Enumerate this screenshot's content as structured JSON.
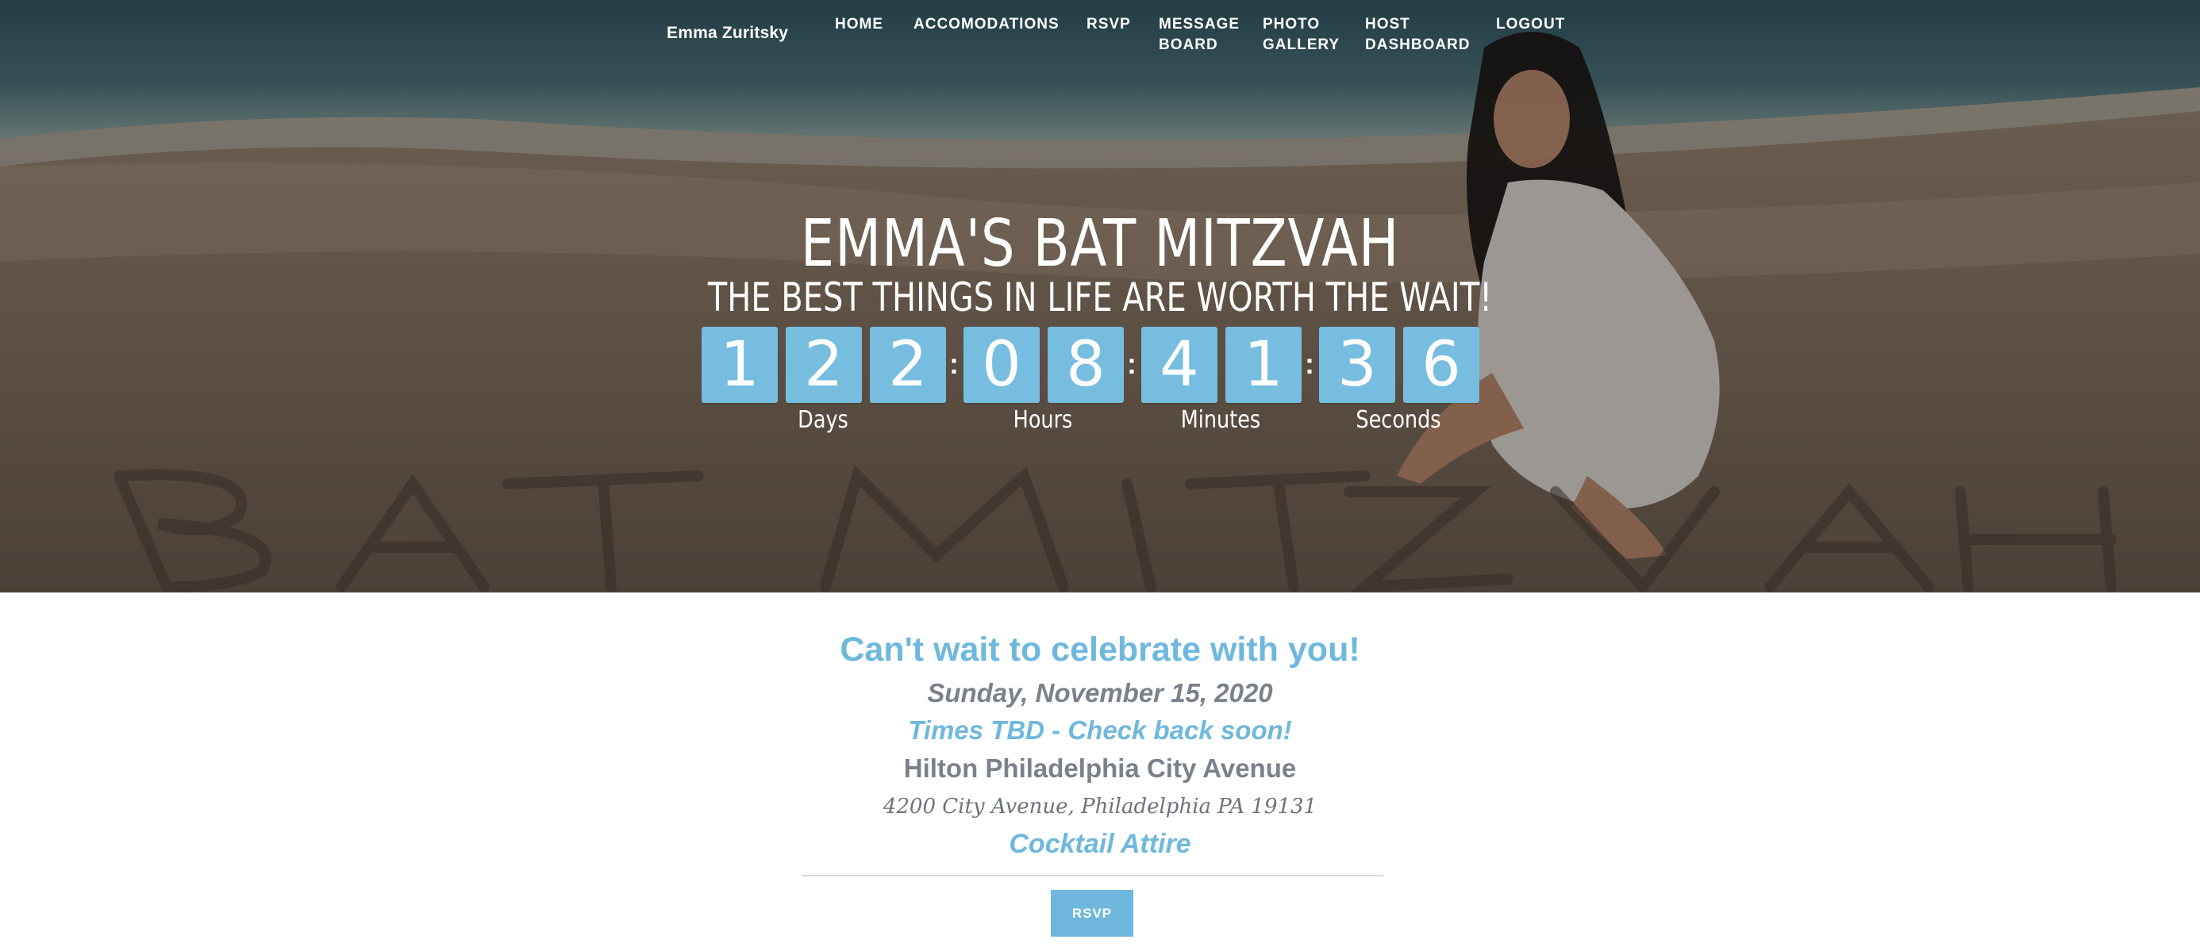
{
  "nav": {
    "brand": "Emma Zuritsky",
    "items": [
      {
        "id": "home",
        "label": "HOME"
      },
      {
        "id": "accomodations",
        "label": "ACCOMODATIONS"
      },
      {
        "id": "rsvp",
        "label": "RSVP"
      },
      {
        "id": "message-board",
        "label": "MESSAGE\nBOARD"
      },
      {
        "id": "photo-gallery",
        "label": "PHOTO\nGALLERY"
      },
      {
        "id": "host-dashboard",
        "label": "HOST\nDASHBOARD"
      },
      {
        "id": "logout",
        "label": "LOGOUT"
      }
    ]
  },
  "hero": {
    "title": "EMMA'S BAT MITZVAH",
    "subtitle": "THE BEST THINGS IN LIFE ARE WORTH THE WAIT!",
    "sand_writing": "BAT MITZVAH"
  },
  "countdown": {
    "days": [
      "1",
      "2",
      "2"
    ],
    "hours": [
      "0",
      "8"
    ],
    "minutes": [
      "4",
      "1"
    ],
    "seconds": [
      "3",
      "6"
    ],
    "separator": ":",
    "labels": {
      "days": "Days",
      "hours": "Hours",
      "minutes": "Minutes",
      "seconds": "Seconds"
    }
  },
  "details": {
    "headline": "Can't wait to celebrate with you!",
    "date": "Sunday, November 15, 2020",
    "times": "Times TBD - Check back soon!",
    "venue": "Hilton Philadelphia City Avenue",
    "address": "4200 City Avenue, Philadelphia PA 19131",
    "attire": "Cocktail Attire",
    "rsvp_button": "RSVP"
  },
  "colors": {
    "accent": "#6fb8dd",
    "countdown_tile": "#76bde0",
    "muted_text": "#7a818a"
  }
}
